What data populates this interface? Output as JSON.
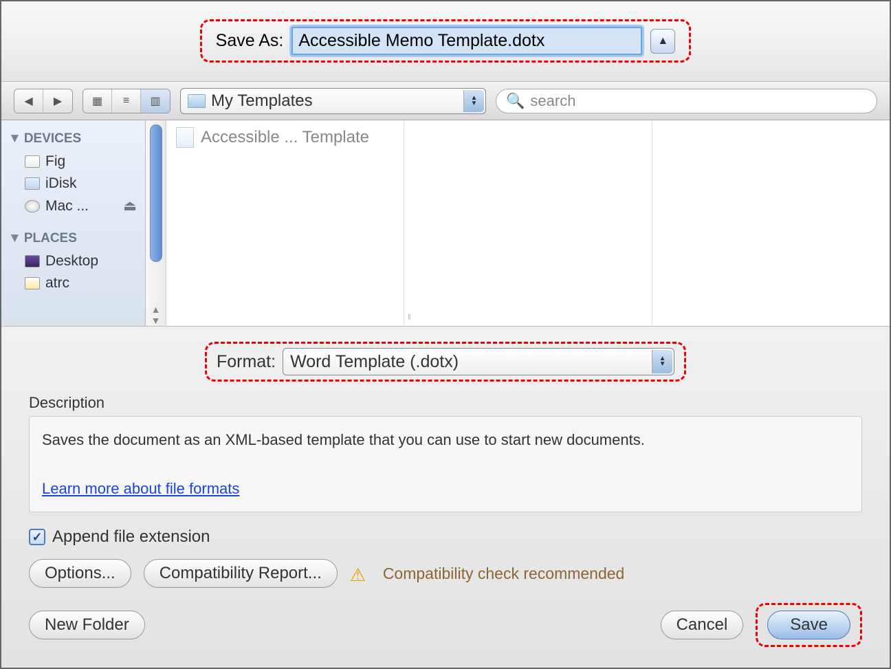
{
  "saveAs": {
    "label": "Save As:",
    "value": "Accessible Memo Template.dotx"
  },
  "toolbar": {
    "location": "My Templates",
    "searchPlaceholder": "search"
  },
  "sidebar": {
    "devicesHeader": "DEVICES",
    "devices": [
      {
        "label": "Fig"
      },
      {
        "label": "iDisk"
      },
      {
        "label": "Mac ..."
      }
    ],
    "placesHeader": "PLACES",
    "places": [
      {
        "label": "Desktop"
      },
      {
        "label": "atrc"
      }
    ]
  },
  "fileList": {
    "item": "Accessible ... Template"
  },
  "format": {
    "label": "Format:",
    "value": "Word Template (.dotx)"
  },
  "description": {
    "label": "Description",
    "text": "Saves the document as an XML-based template that you can use to start new documents.",
    "link": "Learn more about file formats"
  },
  "appendExtension": {
    "label": "Append file extension",
    "checked": true
  },
  "buttons": {
    "options": "Options...",
    "compatReport": "Compatibility Report...",
    "compatWarning": "Compatibility check recommended",
    "newFolder": "New Folder",
    "cancel": "Cancel",
    "save": "Save"
  }
}
